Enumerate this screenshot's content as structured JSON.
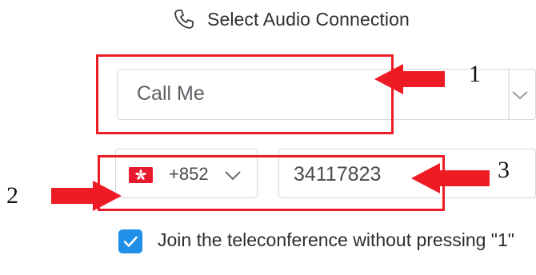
{
  "header": {
    "title": "Select Audio Connection",
    "icon": "phone-icon"
  },
  "audio_select": {
    "value": "Call Me",
    "icon": "chevron-down-icon"
  },
  "country_select": {
    "flag": "hong-kong-flag-icon",
    "code": "+852",
    "icon": "chevron-down-icon"
  },
  "phone_input": {
    "value": "34117823"
  },
  "checkbox": {
    "checked": true,
    "label": "Join the teleconference without pressing \"1\""
  },
  "annotations": {
    "n1": "1",
    "n2": "2",
    "n3": "3",
    "color": "#ee1b24"
  },
  "colors": {
    "accent": "#1f8fe8",
    "flag_red": "#e8192c"
  }
}
